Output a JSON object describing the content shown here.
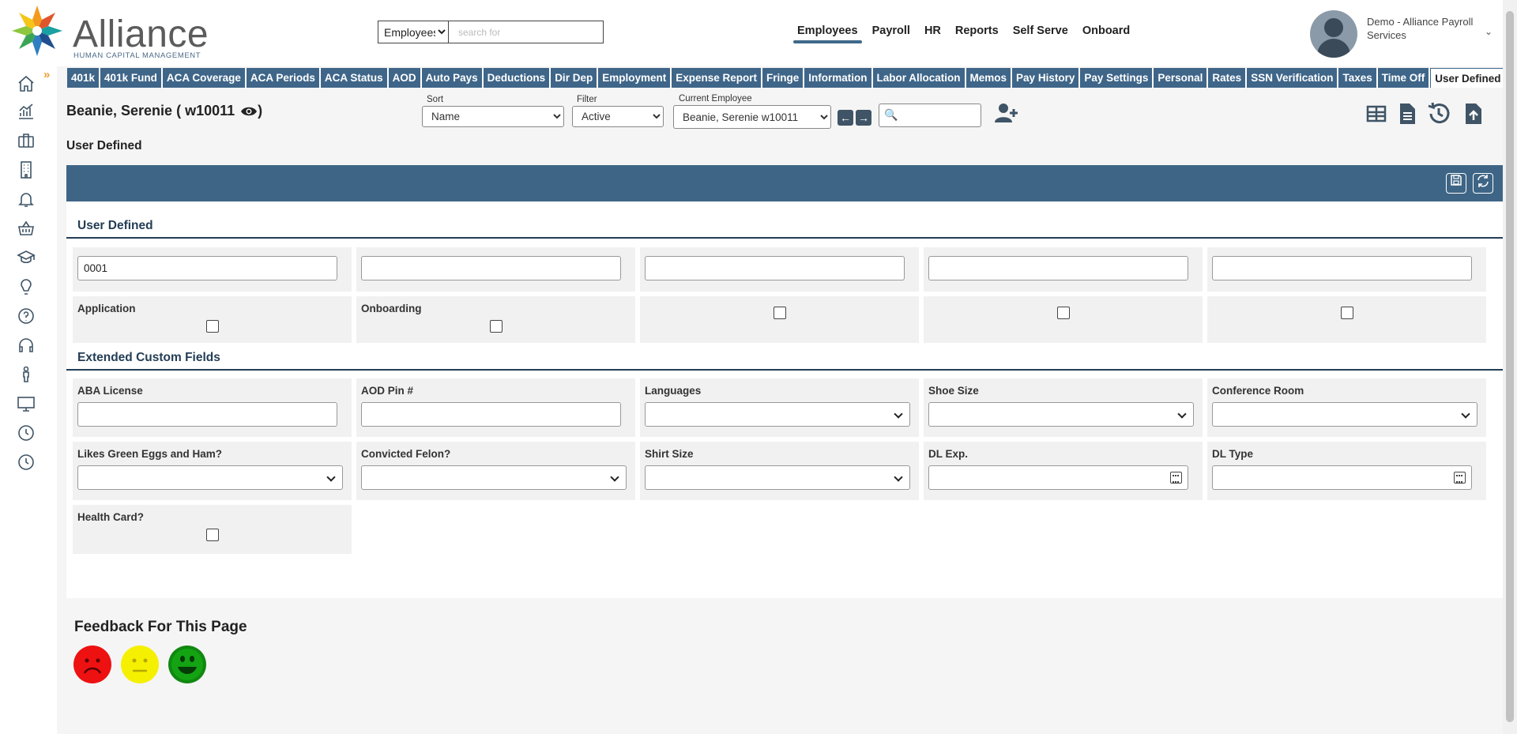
{
  "logo": {
    "name": "Alliance",
    "subtitle": "HUMAN CAPITAL MANAGEMENT"
  },
  "search": {
    "scope": "Employees",
    "placeholder": "search for"
  },
  "topnav": [
    {
      "label": "Employees"
    },
    {
      "label": "Payroll"
    },
    {
      "label": "HR"
    },
    {
      "label": "Reports"
    },
    {
      "label": "Self Serve"
    },
    {
      "label": "Onboard"
    }
  ],
  "user": {
    "name": "Demo - Alliance Payroll Services"
  },
  "tabs": [
    "401k",
    "401k Fund",
    "ACA Coverage",
    "ACA Periods",
    "ACA Status",
    "AOD",
    "Auto Pays",
    "Deductions",
    "Dir Dep",
    "Employment",
    "Expense Report",
    "Fringe",
    "Information",
    "Labor Allocation",
    "Memos",
    "Pay History",
    "Pay Settings",
    "Personal",
    "Rates",
    "SSN Verification",
    "Taxes",
    "Time Off",
    "User Defined"
  ],
  "active_tab": "User Defined",
  "employee": {
    "title": "Beanie, Serenie ( w10011"
  },
  "controls": {
    "sort_label": "Sort",
    "sort_value": "Name",
    "filter_label": "Filter",
    "filter_value": "Active",
    "current_label": "Current Employee",
    "current_value": "Beanie, Serenie w10011"
  },
  "page_title": "User Defined",
  "user_defined": {
    "title": "User Defined",
    "text_values": [
      "0001",
      "",
      "",
      "",
      ""
    ],
    "checkboxes": [
      {
        "label": "Application",
        "checked": false
      },
      {
        "label": "Onboarding",
        "checked": false
      },
      {
        "label": "",
        "checked": false
      },
      {
        "label": "",
        "checked": false
      },
      {
        "label": "",
        "checked": false
      }
    ]
  },
  "extended": {
    "title": "Extended Custom Fields",
    "row1": [
      {
        "label": "ABA License",
        "kind": "text"
      },
      {
        "label": "AOD Pin #",
        "kind": "text"
      },
      {
        "label": "Languages",
        "kind": "select"
      },
      {
        "label": "Shoe Size",
        "kind": "select"
      },
      {
        "label": "Conference Room",
        "kind": "select"
      }
    ],
    "row2": [
      {
        "label": "Likes Green Eggs and Ham?",
        "kind": "select"
      },
      {
        "label": "Convicted Felon?",
        "kind": "select"
      },
      {
        "label": "Shirt Size",
        "kind": "select"
      },
      {
        "label": "DL Exp.",
        "kind": "date"
      },
      {
        "label": "DL Type",
        "kind": "date"
      }
    ],
    "row3": [
      {
        "label": "Health Card?",
        "kind": "checkbox"
      }
    ]
  },
  "feedback": {
    "title": "Feedback For This Page"
  },
  "colors": {
    "nav_blue": "#3f6689",
    "bar_blue": "#3e6585",
    "sad": "#ee1111",
    "neutral": "#f5f000",
    "happy": "#118811"
  }
}
